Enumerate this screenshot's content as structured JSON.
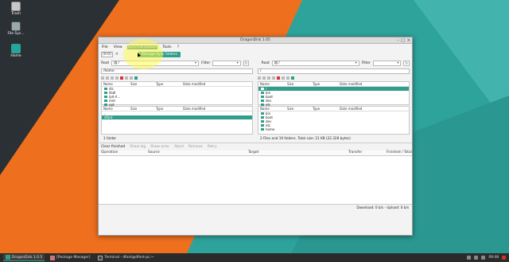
{
  "desktop": {
    "icons": [
      {
        "label": "Trash"
      },
      {
        "label": "File Sys..."
      },
      {
        "label": "Home"
      }
    ]
  },
  "window": {
    "title": "DragonDisk 1.05",
    "menu": [
      "File",
      "View",
      "Synchronization",
      "Tools",
      "?"
    ],
    "menu_active_index": 2,
    "toolbar": {
      "config": "[0:0]",
      "tab_button": "Manage Sync folders"
    },
    "left": {
      "root_label": "Root",
      "root_value": "/",
      "filter_label": "Filter",
      "path": "/home",
      "tree_header": [
        "Name",
        "Size",
        "Type",
        "Date modified"
      ],
      "tree_rows": [
        "dic",
        "libdl",
        "lpd-rl...",
        "mnt",
        "opt"
      ],
      "list_header": [
        "Name",
        "Size",
        "Type",
        "Date modified"
      ],
      "list_rows": [
        "..",
        "dfant"
      ],
      "list_selected": 1,
      "status": "1 folder"
    },
    "right": {
      "root_label": "Root",
      "root_value": "/",
      "filter_label": "Filter",
      "path": "/",
      "tree_header": [
        "Name",
        "Size",
        "Type",
        "Date modified"
      ],
      "tree_rows": [
        "/",
        "bin",
        "boot",
        "dev",
        "etc"
      ],
      "tree_selected": 0,
      "list_header": [
        "Name",
        "Size",
        "Type",
        "Date modified"
      ],
      "list_rows": [
        "bin",
        "boot",
        "dev",
        "etc",
        "home"
      ],
      "status": "2 Files and 19 folders. Total size: 21 KB (22.328 bytes)"
    },
    "queue": {
      "clear_finished": "Clear finished",
      "buttons": [
        "Show log",
        "Show error",
        "Abort",
        "Remove",
        "Retry"
      ],
      "columns": [
        "Operation",
        "Source",
        "Target",
        "Transfer",
        "Finished / Total"
      ]
    },
    "statusbar": "Download: 0 b/s - Upload: 0 b/s"
  },
  "taskbar": {
    "tasks": [
      "DragonDisk 1.0.5",
      "[Package Manager]",
      "Terminal - dfont@dfont-pc:~"
    ],
    "active_index": 0,
    "clock": "09:48"
  }
}
